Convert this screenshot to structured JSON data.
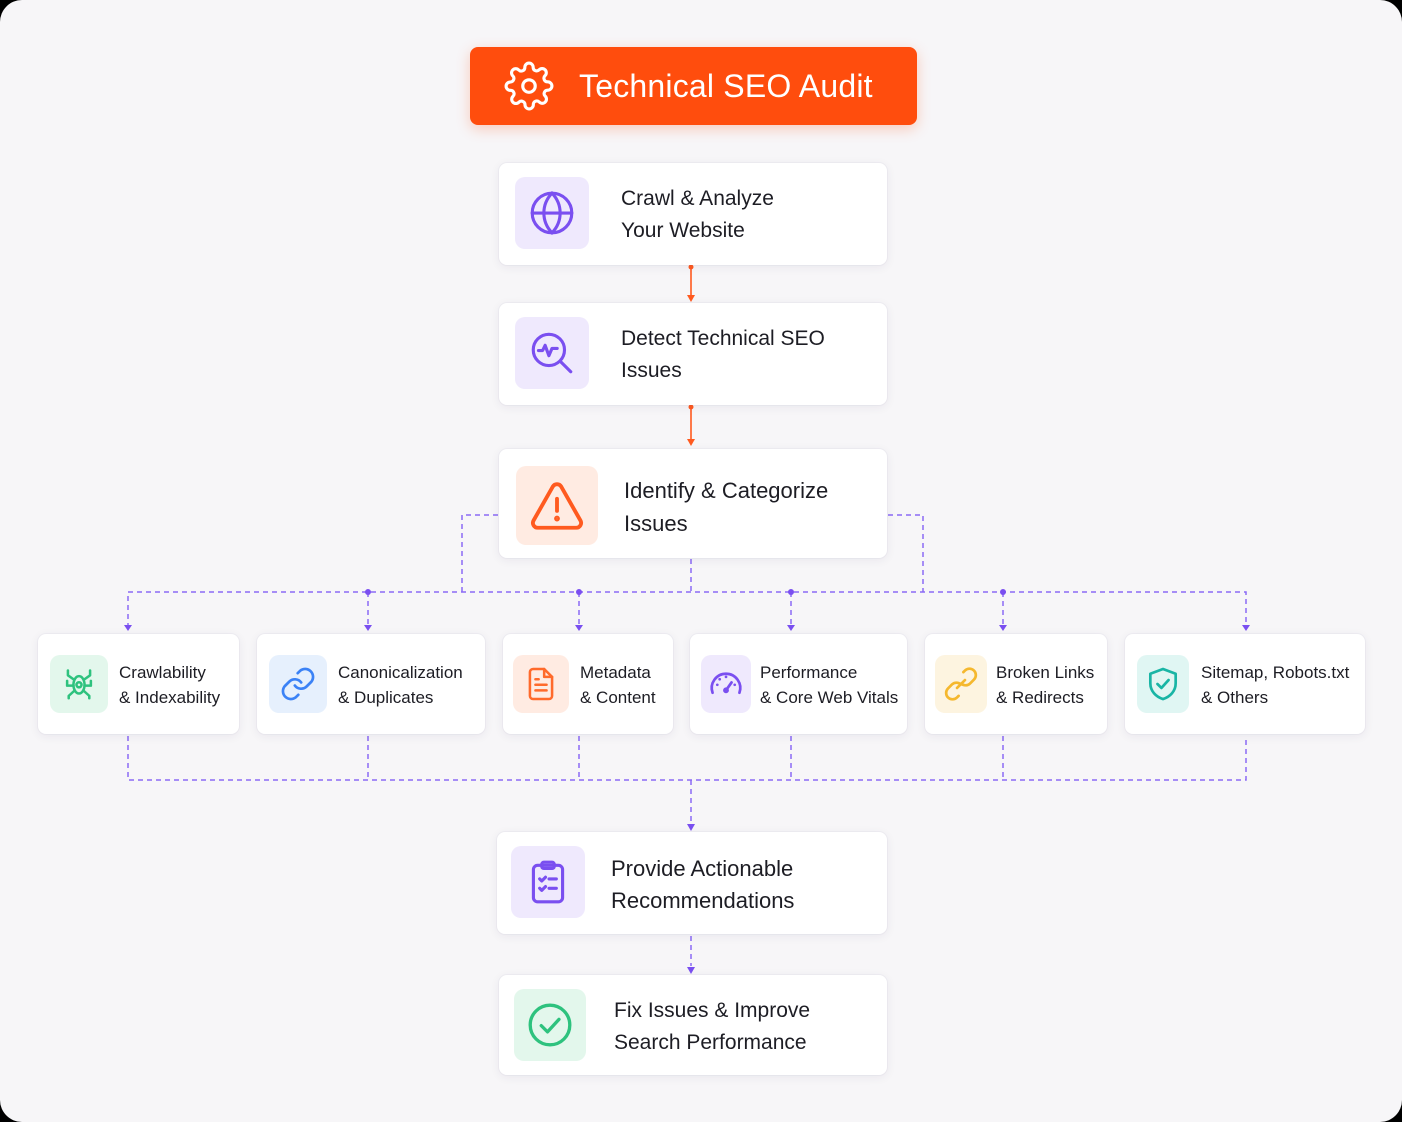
{
  "header": {
    "title": "Technical SEO Audit",
    "icon": "gear-icon"
  },
  "steps": [
    {
      "line1": "Crawl & Analyze",
      "line2": "Your Website",
      "icon": "globe-icon",
      "color": "#7a4ff0"
    },
    {
      "line1": "Detect Technical SEO",
      "line2": "Issues",
      "icon": "magnify-pulse-icon",
      "color": "#7a4ff0"
    },
    {
      "line1": "Identify & Categorize",
      "line2": "Issues",
      "icon": "warning-icon",
      "color": "#ff5a1f"
    }
  ],
  "categories": [
    {
      "line1": "Crawlability",
      "line2": "& Indexability",
      "icon": "bug-icon",
      "color": "#2ec27e"
    },
    {
      "line1": "Canonicalization",
      "line2": "& Duplicates",
      "icon": "link-icon",
      "color": "#3b82f6"
    },
    {
      "line1": "Metadata",
      "line2": "& Content",
      "icon": "document-icon",
      "color": "#ff6a2b"
    },
    {
      "line1": "Performance",
      "line2": "& Core Web Vitals",
      "icon": "gauge-icon",
      "color": "#7a4ff0"
    },
    {
      "line1": "Broken Links",
      "line2": "& Redirects",
      "icon": "broken-link-icon",
      "color": "#f5b82e"
    },
    {
      "line1": "Sitemap, Robots.txt",
      "line2": "& Others",
      "icon": "shield-check-icon",
      "color": "#19b5a5"
    }
  ],
  "final_steps": [
    {
      "line1": "Provide Actionable",
      "line2": "Recommendations",
      "icon": "clipboard-icon",
      "color": "#7a4ff0"
    },
    {
      "line1": "Fix Issues & Improve",
      "line2": "Search Performance",
      "icon": "check-circle-icon",
      "color": "#2ec27e"
    }
  ],
  "colors": {
    "accent": "#ff4d0d",
    "connector_orange": "#ff5a1f",
    "connector_purple": "#7a4ff0"
  }
}
